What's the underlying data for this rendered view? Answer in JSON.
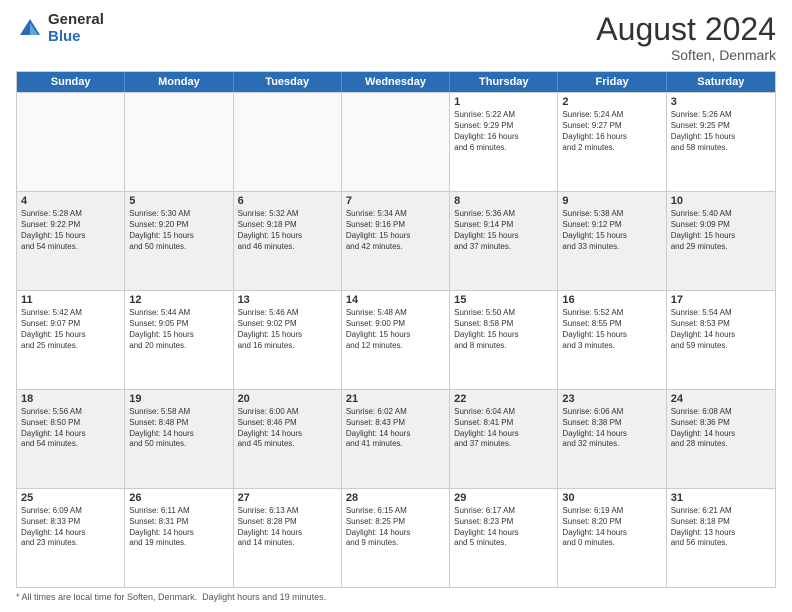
{
  "header": {
    "logo_general": "General",
    "logo_blue": "Blue",
    "month_year": "August 2024",
    "location": "Soften, Denmark"
  },
  "calendar": {
    "days": [
      "Sunday",
      "Monday",
      "Tuesday",
      "Wednesday",
      "Thursday",
      "Friday",
      "Saturday"
    ],
    "rows": [
      [
        {
          "day": "",
          "content": "",
          "empty": true
        },
        {
          "day": "",
          "content": "",
          "empty": true
        },
        {
          "day": "",
          "content": "",
          "empty": true
        },
        {
          "day": "",
          "content": "",
          "empty": true
        },
        {
          "day": "1",
          "content": "Sunrise: 5:22 AM\nSunset: 9:29 PM\nDaylight: 16 hours\nand 6 minutes."
        },
        {
          "day": "2",
          "content": "Sunrise: 5:24 AM\nSunset: 9:27 PM\nDaylight: 16 hours\nand 2 minutes."
        },
        {
          "day": "3",
          "content": "Sunrise: 5:26 AM\nSunset: 9:25 PM\nDaylight: 15 hours\nand 58 minutes."
        }
      ],
      [
        {
          "day": "4",
          "content": "Sunrise: 5:28 AM\nSunset: 9:22 PM\nDaylight: 15 hours\nand 54 minutes.",
          "shaded": true
        },
        {
          "day": "5",
          "content": "Sunrise: 5:30 AM\nSunset: 9:20 PM\nDaylight: 15 hours\nand 50 minutes.",
          "shaded": true
        },
        {
          "day": "6",
          "content": "Sunrise: 5:32 AM\nSunset: 9:18 PM\nDaylight: 15 hours\nand 46 minutes.",
          "shaded": true
        },
        {
          "day": "7",
          "content": "Sunrise: 5:34 AM\nSunset: 9:16 PM\nDaylight: 15 hours\nand 42 minutes.",
          "shaded": true
        },
        {
          "day": "8",
          "content": "Sunrise: 5:36 AM\nSunset: 9:14 PM\nDaylight: 15 hours\nand 37 minutes.",
          "shaded": true
        },
        {
          "day": "9",
          "content": "Sunrise: 5:38 AM\nSunset: 9:12 PM\nDaylight: 15 hours\nand 33 minutes.",
          "shaded": true
        },
        {
          "day": "10",
          "content": "Sunrise: 5:40 AM\nSunset: 9:09 PM\nDaylight: 15 hours\nand 29 minutes.",
          "shaded": true
        }
      ],
      [
        {
          "day": "11",
          "content": "Sunrise: 5:42 AM\nSunset: 9:07 PM\nDaylight: 15 hours\nand 25 minutes."
        },
        {
          "day": "12",
          "content": "Sunrise: 5:44 AM\nSunset: 9:05 PM\nDaylight: 15 hours\nand 20 minutes."
        },
        {
          "day": "13",
          "content": "Sunrise: 5:46 AM\nSunset: 9:02 PM\nDaylight: 15 hours\nand 16 minutes."
        },
        {
          "day": "14",
          "content": "Sunrise: 5:48 AM\nSunset: 9:00 PM\nDaylight: 15 hours\nand 12 minutes."
        },
        {
          "day": "15",
          "content": "Sunrise: 5:50 AM\nSunset: 8:58 PM\nDaylight: 15 hours\nand 8 minutes."
        },
        {
          "day": "16",
          "content": "Sunrise: 5:52 AM\nSunset: 8:55 PM\nDaylight: 15 hours\nand 3 minutes."
        },
        {
          "day": "17",
          "content": "Sunrise: 5:54 AM\nSunset: 8:53 PM\nDaylight: 14 hours\nand 59 minutes."
        }
      ],
      [
        {
          "day": "18",
          "content": "Sunrise: 5:56 AM\nSunset: 8:50 PM\nDaylight: 14 hours\nand 54 minutes.",
          "shaded": true
        },
        {
          "day": "19",
          "content": "Sunrise: 5:58 AM\nSunset: 8:48 PM\nDaylight: 14 hours\nand 50 minutes.",
          "shaded": true
        },
        {
          "day": "20",
          "content": "Sunrise: 6:00 AM\nSunset: 8:46 PM\nDaylight: 14 hours\nand 45 minutes.",
          "shaded": true
        },
        {
          "day": "21",
          "content": "Sunrise: 6:02 AM\nSunset: 8:43 PM\nDaylight: 14 hours\nand 41 minutes.",
          "shaded": true
        },
        {
          "day": "22",
          "content": "Sunrise: 6:04 AM\nSunset: 8:41 PM\nDaylight: 14 hours\nand 37 minutes.",
          "shaded": true
        },
        {
          "day": "23",
          "content": "Sunrise: 6:06 AM\nSunset: 8:38 PM\nDaylight: 14 hours\nand 32 minutes.",
          "shaded": true
        },
        {
          "day": "24",
          "content": "Sunrise: 6:08 AM\nSunset: 8:36 PM\nDaylight: 14 hours\nand 28 minutes.",
          "shaded": true
        }
      ],
      [
        {
          "day": "25",
          "content": "Sunrise: 6:09 AM\nSunset: 8:33 PM\nDaylight: 14 hours\nand 23 minutes."
        },
        {
          "day": "26",
          "content": "Sunrise: 6:11 AM\nSunset: 8:31 PM\nDaylight: 14 hours\nand 19 minutes."
        },
        {
          "day": "27",
          "content": "Sunrise: 6:13 AM\nSunset: 8:28 PM\nDaylight: 14 hours\nand 14 minutes."
        },
        {
          "day": "28",
          "content": "Sunrise: 6:15 AM\nSunset: 8:25 PM\nDaylight: 14 hours\nand 9 minutes."
        },
        {
          "day": "29",
          "content": "Sunrise: 6:17 AM\nSunset: 8:23 PM\nDaylight: 14 hours\nand 5 minutes."
        },
        {
          "day": "30",
          "content": "Sunrise: 6:19 AM\nSunset: 8:20 PM\nDaylight: 14 hours\nand 0 minutes."
        },
        {
          "day": "31",
          "content": "Sunrise: 6:21 AM\nSunset: 8:18 PM\nDaylight: 13 hours\nand 56 minutes."
        }
      ]
    ]
  },
  "footer": {
    "part1": "* All times are local time for Soften, Denmark.",
    "part2": "Daylight hours",
    "part3": "and 19"
  }
}
